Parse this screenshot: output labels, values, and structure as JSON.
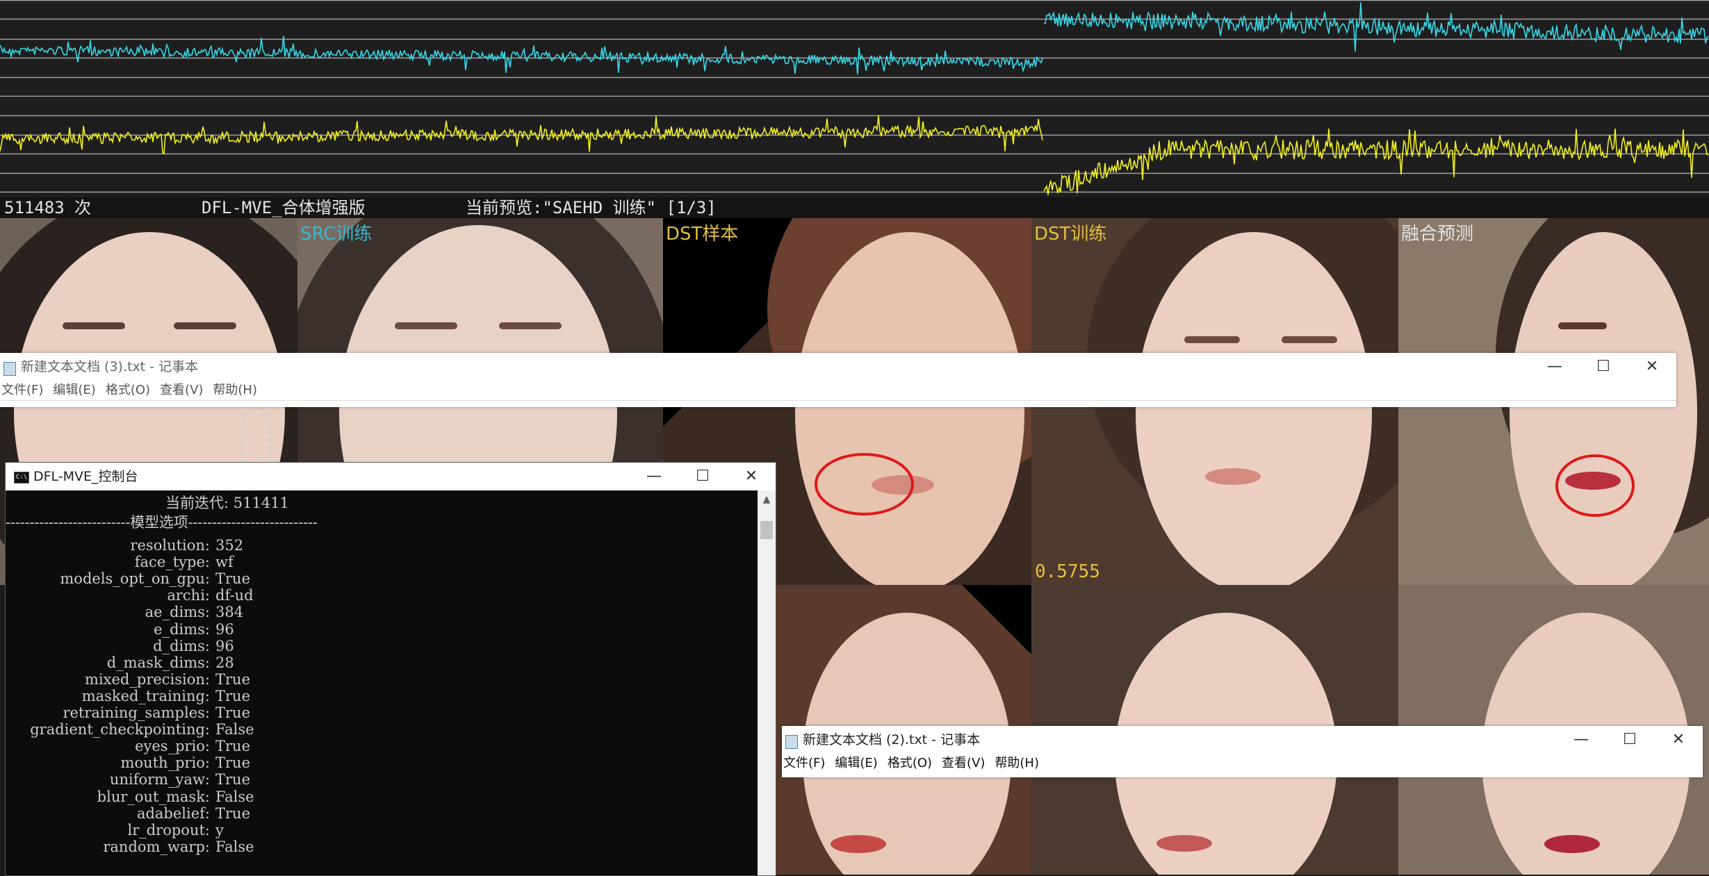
{
  "status_bar": {
    "iterations": "511483 次",
    "app_name": "DFL-MVE_合体增强版",
    "preview": "当前预览:\"SAEHD 训练\" [1/3]"
  },
  "preview": {
    "labels": [
      "SRC训练",
      "DST样本",
      "DST训练",
      "融合预测"
    ],
    "loss_value": "0.5755",
    "colors": {
      "src_label": "#35b8d0",
      "dst_label": "#e0c040",
      "merge_label": "#e6e6e6",
      "highlight_circle": "#e01818"
    }
  },
  "graph": {
    "colors": {
      "src_loss": "#38d8e8",
      "dst_loss": "#f0f020",
      "gridline": "#a0a0a0"
    }
  },
  "notepad_top": {
    "title": "新建文本文档 (3).txt - 记事本",
    "menu": [
      "文件(F)",
      "编辑(E)",
      "格式(O)",
      "查看(V)",
      "帮助(H)"
    ],
    "controls": {
      "minimize": "—",
      "maximize": "☐",
      "close": "✕"
    }
  },
  "notepad_bottom": {
    "title": "新建文本文档 (2).txt - 记事本",
    "menu": [
      "文件(F)",
      "编辑(E)",
      "格式(O)",
      "查看(V)",
      "帮助(H)"
    ],
    "controls": {
      "minimize": "—",
      "maximize": "☐",
      "close": "✕"
    }
  },
  "console": {
    "title": "DFL-MVE_控制台",
    "icon_text": "C:\\",
    "current_iteration": "当前迭代: 511411",
    "section_header": "--------------------------模型选项---------------------------",
    "options": [
      {
        "key": "resolution:",
        "value": "352"
      },
      {
        "key": "face_type:",
        "value": "wf"
      },
      {
        "key": "models_opt_on_gpu:",
        "value": "True"
      },
      {
        "key": "archi:",
        "value": "df-ud"
      },
      {
        "key": "ae_dims:",
        "value": "384"
      },
      {
        "key": "e_dims:",
        "value": "96"
      },
      {
        "key": "d_dims:",
        "value": "96"
      },
      {
        "key": "d_mask_dims:",
        "value": "28"
      },
      {
        "key": "mixed_precision:",
        "value": "True"
      },
      {
        "key": "masked_training:",
        "value": "True"
      },
      {
        "key": "retraining_samples:",
        "value": "True"
      },
      {
        "key": "gradient_checkpointing:",
        "value": "False"
      },
      {
        "key": "eyes_prio:",
        "value": "True"
      },
      {
        "key": "mouth_prio:",
        "value": "True"
      },
      {
        "key": "uniform_yaw:",
        "value": "True"
      },
      {
        "key": "blur_out_mask:",
        "value": "False"
      },
      {
        "key": "adabelief:",
        "value": "True"
      },
      {
        "key": "lr_dropout:",
        "value": "y"
      },
      {
        "key": "random_warp:",
        "value": "False"
      }
    ],
    "controls": {
      "minimize": "—",
      "maximize": "☐",
      "close": "✕"
    },
    "scroll_up": "▲"
  }
}
